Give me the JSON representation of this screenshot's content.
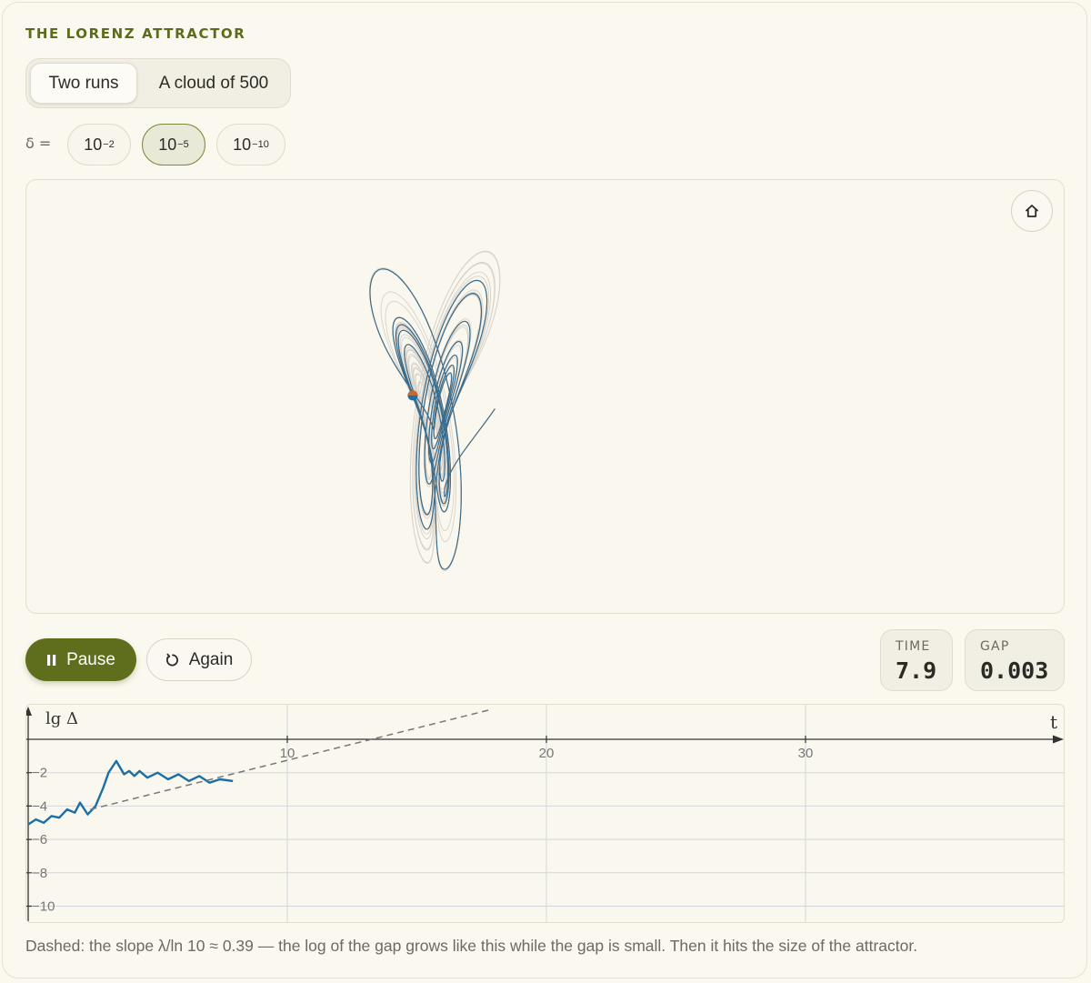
{
  "eyebrow": "THE LORENZ ATTRACTOR",
  "mode_tabs": [
    {
      "label": "Two runs",
      "active": true
    },
    {
      "label": "A cloud of 500",
      "active": false
    }
  ],
  "delta": {
    "label": "δ =",
    "options": [
      {
        "base": "10",
        "exp": "−2",
        "active": false
      },
      {
        "base": "10",
        "exp": "−5",
        "active": true
      },
      {
        "base": "10",
        "exp": "−10",
        "active": false
      }
    ]
  },
  "controls": {
    "pause_label": "Pause",
    "again_label": "Again"
  },
  "stats": {
    "time_label": "TIME",
    "time_value": "7.9",
    "gap_label": "GAP",
    "gap_value": "0.003"
  },
  "colors": {
    "accent": "#5f6e1d",
    "run_a": "#1a6fa6",
    "run_b": "#c86a2a",
    "cloud": "#cfcdc6"
  },
  "chart_data": {
    "type": "line",
    "ylabel": "lg Δ",
    "xlabel": "t",
    "x_ticks": [
      "10",
      "20",
      "30"
    ],
    "y_ticks": [
      "−2",
      "−4",
      "−6",
      "−8",
      "−10"
    ],
    "xlim": [
      0,
      40
    ],
    "ylim": [
      -11,
      1.8
    ],
    "series": [
      {
        "style": "solid",
        "x": [
          0,
          0.3,
          0.6,
          0.9,
          1.2,
          1.5,
          1.8,
          2.0,
          2.3,
          2.6,
          2.9,
          3.1,
          3.4,
          3.7,
          3.9,
          4.1,
          4.3,
          4.6,
          5.0,
          5.4,
          5.8,
          6.2,
          6.6,
          7.0,
          7.4,
          7.9
        ],
        "y": [
          -5.1,
          -4.8,
          -5.0,
          -4.6,
          -4.7,
          -4.2,
          -4.4,
          -3.8,
          -4.5,
          -4.0,
          -2.9,
          -2.0,
          -1.3,
          -2.1,
          -1.9,
          -2.2,
          -1.9,
          -2.3,
          -2.0,
          -2.4,
          -2.1,
          -2.5,
          -2.2,
          -2.6,
          -2.4,
          -2.5
        ]
      },
      {
        "style": "dashed",
        "x": [
          2.4,
          17.9
        ],
        "y": [
          -4.2,
          1.8
        ]
      }
    ]
  }
}
